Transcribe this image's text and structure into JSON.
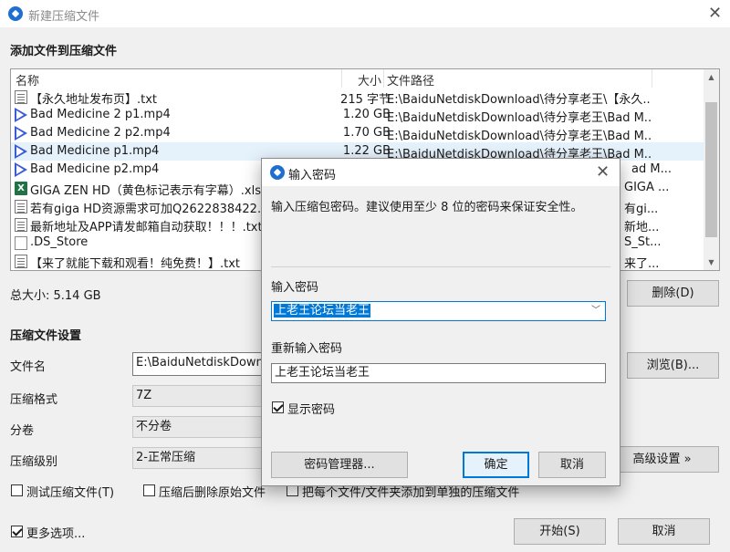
{
  "window": {
    "title": "新建压缩文件",
    "close": "✕"
  },
  "add_section": {
    "title": "添加文件到压缩文件"
  },
  "file_list": {
    "columns": {
      "name": "名称",
      "size": "大小",
      "path": "文件路径"
    },
    "rows": [
      {
        "icon": "txt",
        "name": "【永久地址发布页】.txt",
        "size": "215 字节",
        "path": "E:\\BaiduNetdiskDownload\\待分享老王\\【永久..."
      },
      {
        "icon": "mp4",
        "name": "Bad Medicine 2 p1.mp4",
        "size": "1.20 GB",
        "path": "E:\\BaiduNetdiskDownload\\待分享老王\\Bad M..."
      },
      {
        "icon": "mp4",
        "name": "Bad Medicine 2 p2.mp4",
        "size": "1.70 GB",
        "path": "E:\\BaiduNetdiskDownload\\待分享老王\\Bad M..."
      },
      {
        "icon": "mp4",
        "name": "Bad Medicine p1.mp4",
        "size": "1.22 GB",
        "path": "E:\\BaiduNetdiskDownload\\待分享老王\\Bad M...",
        "selected": true
      },
      {
        "icon": "mp4",
        "name": "Bad Medicine p2.mp4",
        "size": "",
        "path": "ad M..."
      },
      {
        "icon": "xls",
        "name": "GIGA ZEN HD（黄色标记表示有字幕）.xlsx",
        "size": "",
        "path": "GIGA ..."
      },
      {
        "icon": "txt",
        "name": "若有giga HD资源需求可加Q2622838422.txt",
        "size": "",
        "path": "有gi..."
      },
      {
        "icon": "txt",
        "name": "最新地址及APP请发邮箱自动获取！！！.txt",
        "size": "",
        "path": "新地..."
      },
      {
        "icon": "blank",
        "name": ".DS_Store",
        "size": "",
        "path": "S_St..."
      },
      {
        "icon": "txt",
        "name": "【来了就能下载和观看！纯免费！】.txt",
        "size": "",
        "path": "来了..."
      }
    ]
  },
  "total_size": "总大小: 5.14 GB",
  "delete_button": "删除(D)",
  "settings": {
    "title": "压缩文件设置",
    "filename_label": "文件名",
    "filename_value": "E:\\BaiduNetdiskDownlo",
    "browse_button": "浏览(B)...",
    "format_label": "压缩格式",
    "format_value": "7Z",
    "volume_label": "分卷",
    "volume_value": "不分卷",
    "level_label": "压缩级别",
    "level_value": "2-正常压缩",
    "advanced_button": "高级设置 »"
  },
  "options": {
    "test_archive": "测试压缩文件(T)",
    "delete_after": "压缩后删除原始文件",
    "each_separately": "把每个文件/文件夹添加到单独的压缩文件",
    "more_options": "更多选项..."
  },
  "footer": {
    "start_button": "开始(S)",
    "cancel_button": "取消"
  },
  "password_dialog": {
    "title": "输入密码",
    "close": "✕",
    "description": "输入压缩包密码。建议使用至少 8 位的密码来保证安全性。",
    "password_label": "输入密码",
    "password_value": "上老王论坛当老王",
    "reenter_label": "重新输入密码",
    "reenter_value": "上老王论坛当老王",
    "show_password": "显示密码",
    "manager_button": "密码管理器...",
    "ok_button": "确定",
    "cancel_button": "取消"
  }
}
